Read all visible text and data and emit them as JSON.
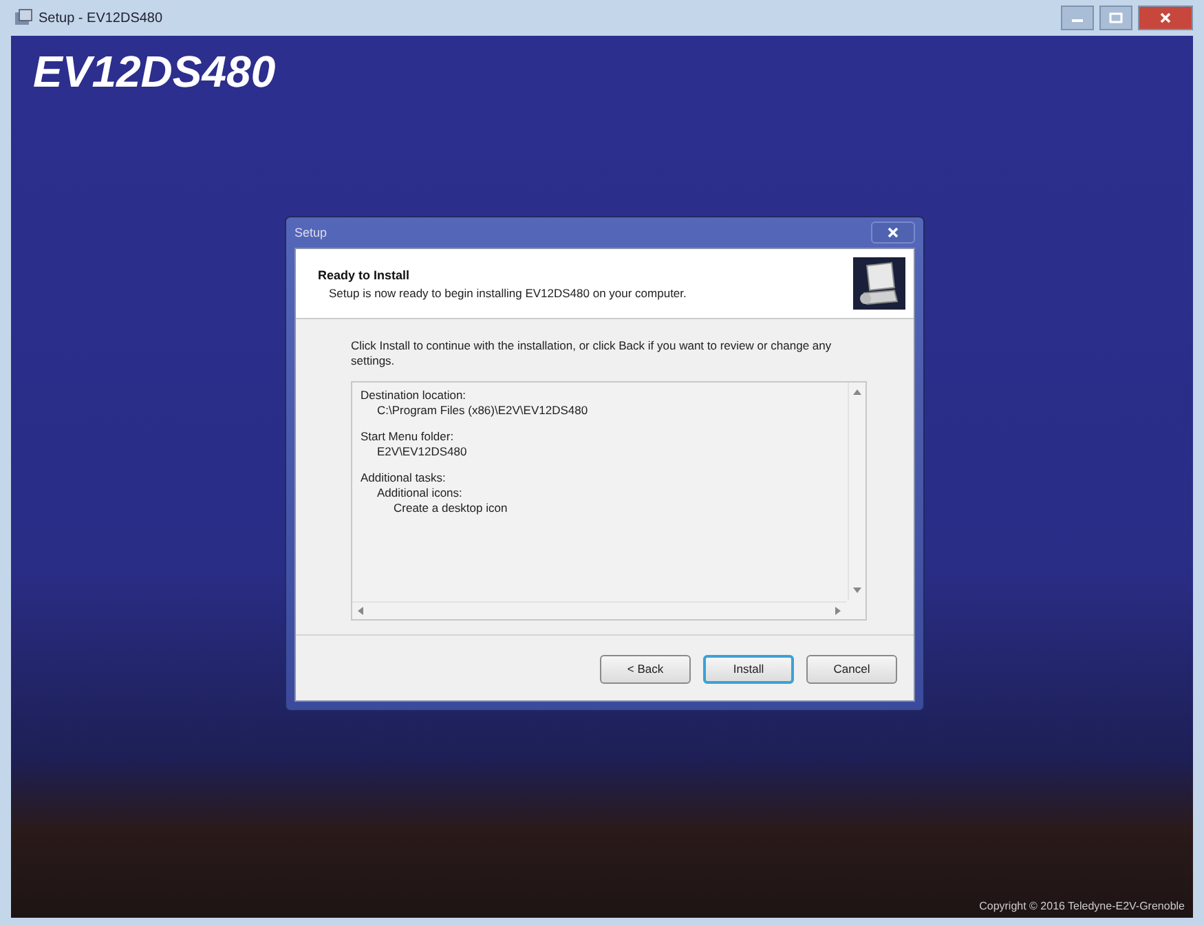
{
  "window": {
    "title": "Setup - EV12DS480"
  },
  "banner": {
    "title": "EV12DS480",
    "copyright": "Copyright © 2016 Teledyne-E2V-Grenoble"
  },
  "dialog": {
    "title": "Setup",
    "heading": "Ready to Install",
    "subheading": "Setup is now ready to begin installing EV12DS480 on your computer.",
    "intro": "Click Install to continue with the installation, or click Back if you want to review or change any settings.",
    "summary": [
      {
        "text": "Destination location:",
        "children": [
          {
            "text": "C:\\Program Files (x86)\\E2V\\EV12DS480"
          }
        ]
      },
      {
        "text": "Start Menu folder:",
        "children": [
          {
            "text": "E2V\\EV12DS480"
          }
        ]
      },
      {
        "text": "Additional tasks:",
        "children": [
          {
            "text": "Additional icons:",
            "children": [
              {
                "text": "Create a desktop icon"
              }
            ]
          }
        ]
      }
    ],
    "buttons": [
      {
        "label": "< Back",
        "focused": false
      },
      {
        "label": "Install",
        "focused": true
      },
      {
        "label": "Cancel",
        "focused": false
      }
    ]
  }
}
